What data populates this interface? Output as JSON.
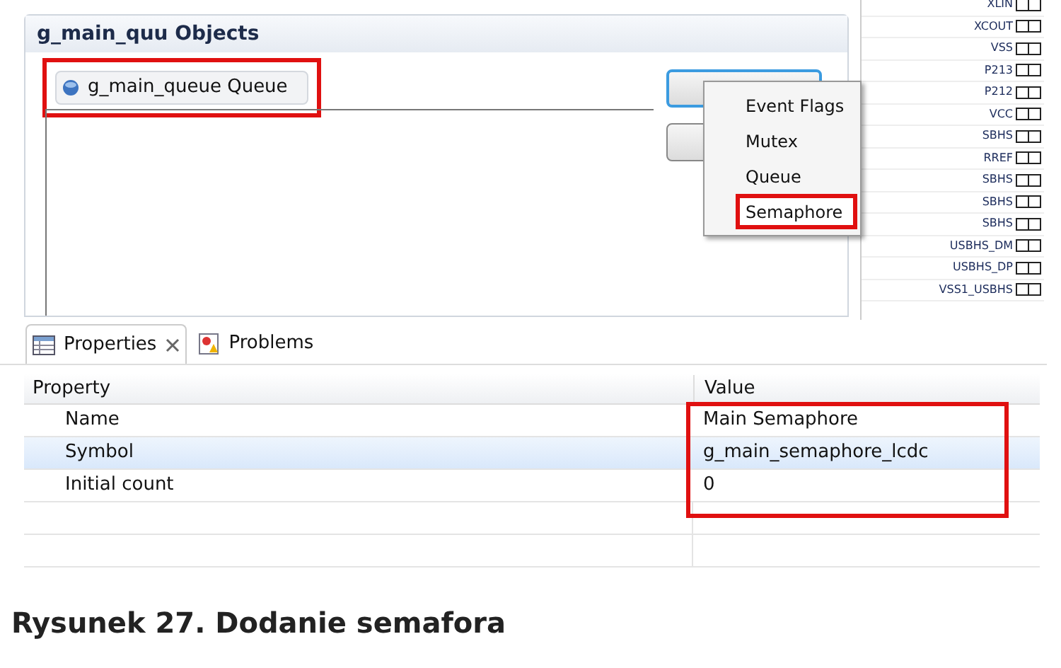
{
  "objects_panel": {
    "title": "g_main_quu Objects",
    "items": [
      {
        "label": "g_main_queue Queue",
        "highlighted": true
      }
    ]
  },
  "buttons": [
    {
      "focused": true
    },
    {
      "focused": false
    }
  ],
  "context_menu": {
    "items": [
      {
        "label": "Event Flags",
        "highlighted": false
      },
      {
        "label": "Mutex",
        "highlighted": false
      },
      {
        "label": "Queue",
        "highlighted": false
      },
      {
        "label": "Semaphore",
        "highlighted": true
      }
    ]
  },
  "pins": [
    "XLIN",
    "XCOUT",
    "VSS",
    "P213",
    "P212",
    "VCC",
    "SBHS",
    "RREF",
    "SBHS",
    "SBHS",
    "SBHS",
    "USBHS_DM",
    "USBHS_DP",
    "VSS1_USBHS"
  ],
  "tabs": [
    {
      "label": "Properties",
      "selected": true,
      "closable": true
    },
    {
      "label": "Problems",
      "selected": false,
      "closable": false
    }
  ],
  "properties_table": {
    "columns": [
      "Property",
      "Value"
    ],
    "values_highlighted": true,
    "rows": [
      {
        "property": "Name",
        "value": "Main Semaphore",
        "selected": false
      },
      {
        "property": "Symbol",
        "value": "g_main_semaphore_lcdc",
        "selected": true
      },
      {
        "property": "Initial count",
        "value": "0",
        "selected": false
      }
    ]
  },
  "caption": "Rysunek 27. Dodanie semafora"
}
